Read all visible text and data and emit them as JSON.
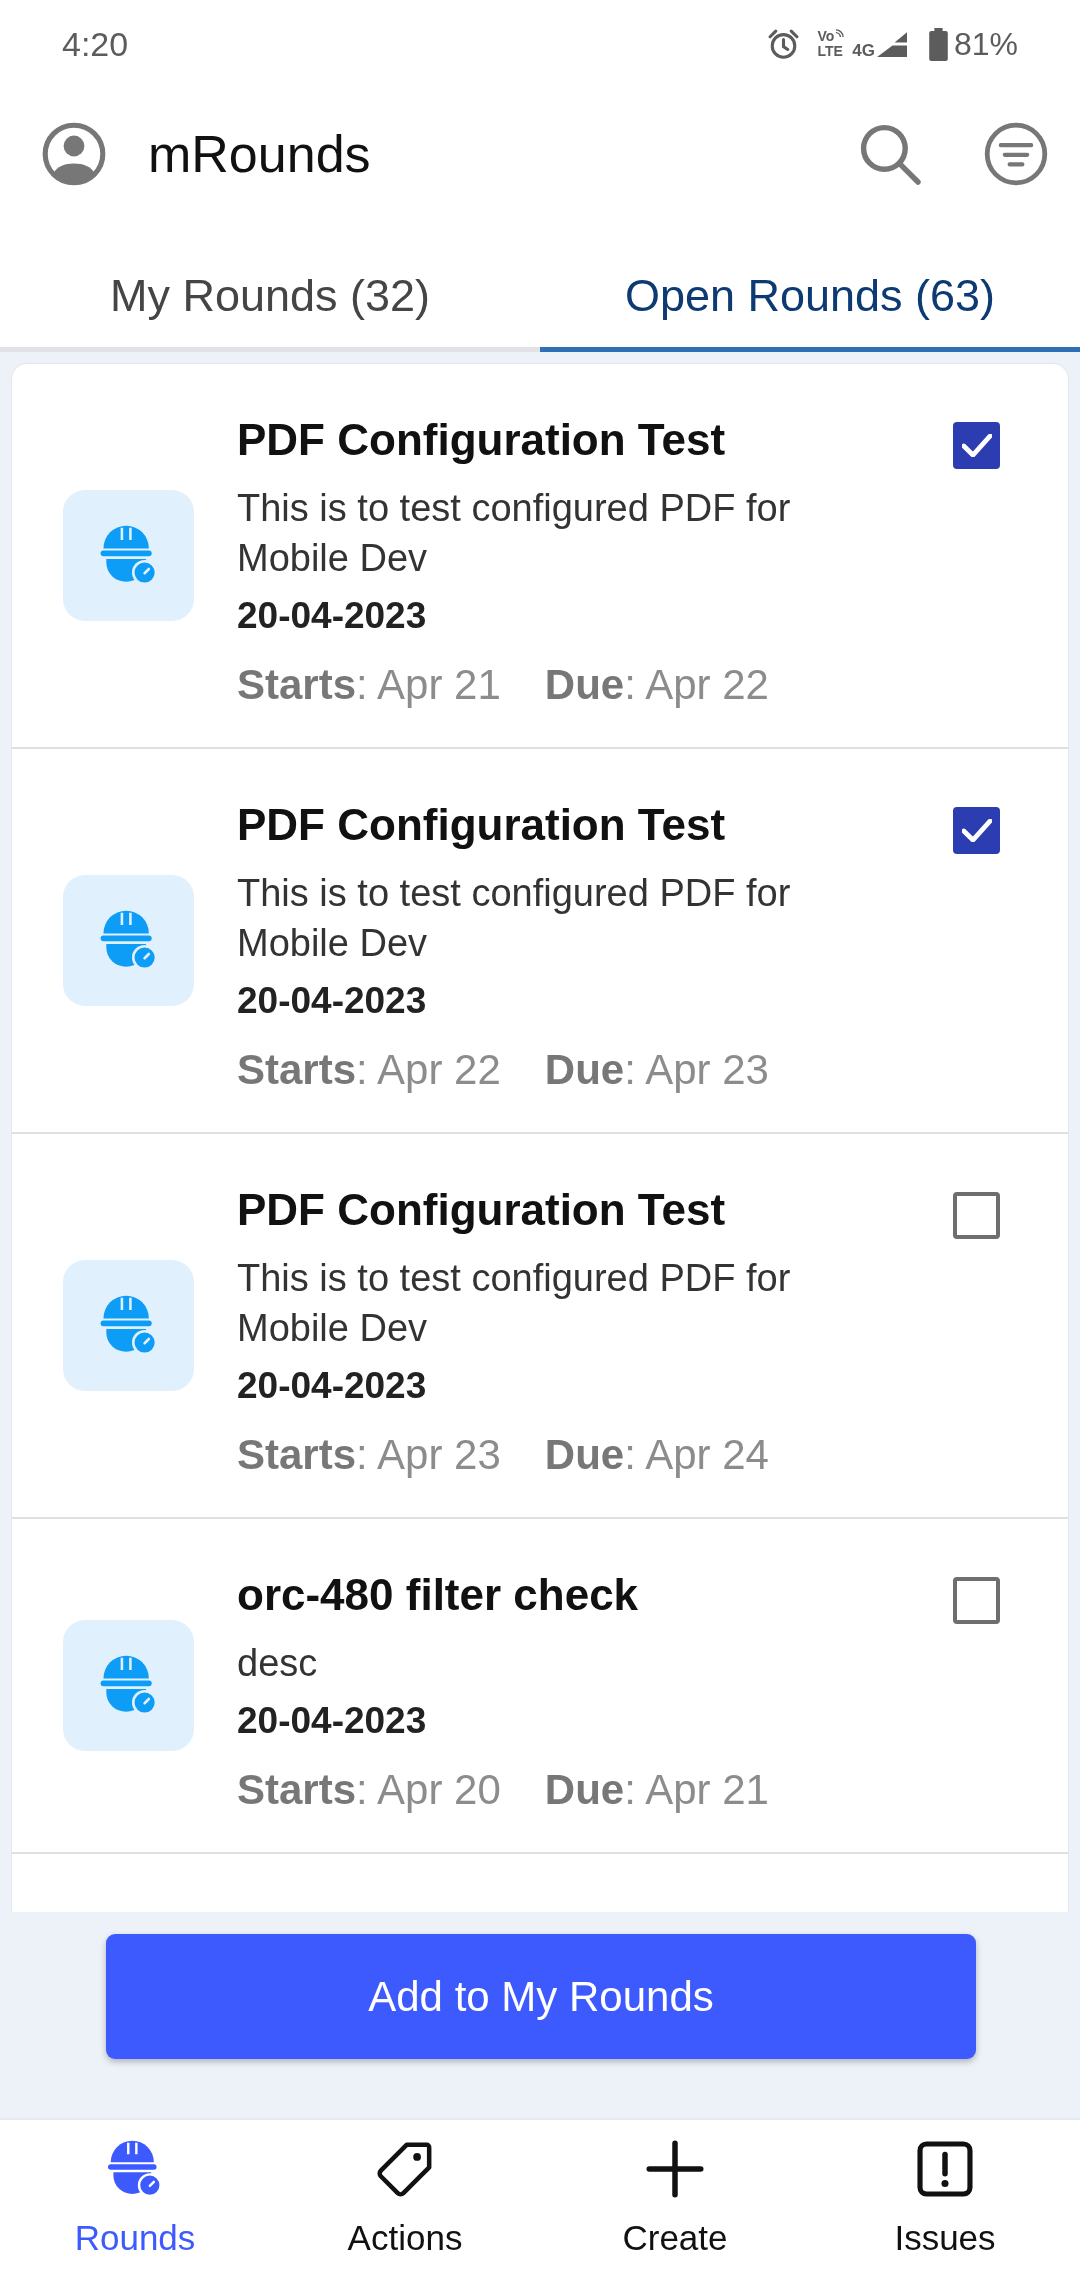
{
  "status_bar": {
    "time": "4:20",
    "volte_top": "Vo",
    "volte_bottom": "LTE",
    "network": "4G",
    "battery": "81%"
  },
  "header": {
    "title": "mRounds"
  },
  "tabs": [
    {
      "label": "My Rounds (32)",
      "selected": false
    },
    {
      "label": "Open Rounds (63)",
      "selected": true
    }
  ],
  "rounds": [
    {
      "title": "PDF Configuration Test",
      "description": "This is to test configured PDF for Mobile Dev",
      "date": "20-04-2023",
      "starts": "**Starts**: Apr 21",
      "due": "**Due**: Apr 22",
      "checked": true
    },
    {
      "title": "PDF Configuration Test",
      "description": "This is to test configured PDF for Mobile Dev",
      "date": "20-04-2023",
      "starts": "**Starts**: Apr 22",
      "due": "**Due**: Apr 23",
      "checked": true
    },
    {
      "title": "PDF Configuration Test",
      "description": "This is to test configured PDF for Mobile Dev",
      "date": "20-04-2023",
      "starts": "**Starts**: Apr 23",
      "due": "**Due**: Apr 24",
      "checked": false
    },
    {
      "title": "orc-480 filter check",
      "description": "desc",
      "date": "20-04-2023",
      "starts": "**Starts**: Apr 20",
      "due": "**Due**: Apr 21",
      "checked": false
    }
  ],
  "action_button": {
    "label": "Add to My Rounds"
  },
  "bottom_nav": [
    {
      "kind": "rounds",
      "label": "Rounds",
      "selected": true
    },
    {
      "kind": "actions",
      "label": "Actions",
      "selected": false
    },
    {
      "kind": "create",
      "label": "Create",
      "selected": false
    },
    {
      "kind": "issues",
      "label": "Issues",
      "selected": false
    }
  ]
}
